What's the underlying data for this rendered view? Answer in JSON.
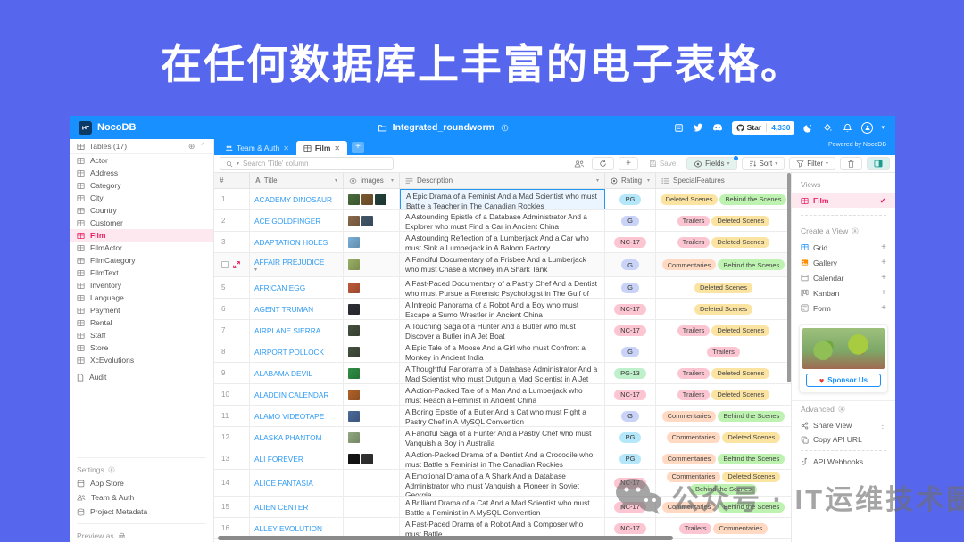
{
  "banner": {
    "title": "在任何数据库上丰富的电子表格。"
  },
  "header": {
    "app_name": "NocoDB",
    "project_name": "Integrated_roundworm",
    "star_label": "Star",
    "star_count": "4,330",
    "powered_by": "Powered by NocoDB",
    "accent_blue": "#1890FF",
    "background_purple": "#5667EE"
  },
  "tabs": [
    {
      "label": "Team & Auth",
      "active": false
    },
    {
      "label": "Film",
      "active": true
    }
  ],
  "left_sidebar": {
    "tables_header": "Tables (17)",
    "tables": [
      "Actor",
      "Address",
      "Category",
      "City",
      "Country",
      "Customer",
      "Film",
      "FilmActor",
      "FilmCategory",
      "FilmText",
      "Inventory",
      "Language",
      "Payment",
      "Rental",
      "Staff",
      "Store",
      "XcEvolutions"
    ],
    "active_table": "Film",
    "audit_label": "Audit",
    "settings_label": "Settings",
    "settings_items": [
      "App Store",
      "Team & Auth",
      "Project Metadata"
    ],
    "preview_label": "Preview as"
  },
  "toolbar": {
    "search_placeholder": "Search 'Title' column",
    "save_label": "Save",
    "fields_label": "Fields",
    "sort_label": "Sort",
    "filter_label": "Filter"
  },
  "table": {
    "columns": [
      "#",
      "Title",
      "images",
      "Description",
      "Rating",
      "SpecialFeatures"
    ],
    "rating_colors": {
      "G": "#C9D3F7",
      "PG": "#B5E7FB",
      "PG-13": "#BDF0CB",
      "NC-17": "#FBC6D2"
    },
    "feature_colors": {
      "Trailers": "#FBC6D2",
      "Deleted Scenes": "#FBE3A1",
      "Behind the Scenes": "#BDF2B0",
      "Commentaries": "#FFD9C2"
    },
    "rows": [
      {
        "num": "1",
        "title": "ACADEMY DINOSAUR",
        "thumbs": [
          "#4a6b3a",
          "#7a5a30",
          "#23423a"
        ],
        "desc": "A Epic Drama of a Feminist And a Mad Scientist who must Battle a Teacher in The Canadian Rockies",
        "rating": "PG",
        "features": [
          "Deleted Scenes",
          "Behind the Scenes"
        ],
        "desc_selected": true
      },
      {
        "num": "2",
        "title": "ACE GOLDFINGER",
        "thumbs": [
          "#8a6a4a",
          "#44586b"
        ],
        "desc": "A Astounding Epistle of a Database Administrator And a Explorer who must Find a Car in Ancient China",
        "rating": "G",
        "features": [
          "Trailers",
          "Deleted Scenes"
        ]
      },
      {
        "num": "3",
        "title": "ADAPTATION HOLES",
        "thumbs": [
          "#7ab0d8"
        ],
        "desc": "A Astounding Reflection of a Lumberjack And a Car who must Sink a Lumberjack in A Baloon Factory",
        "rating": "NC-17",
        "features": [
          "Trailers",
          "Deleted Scenes"
        ]
      },
      {
        "num": "4",
        "title": "AFFAIR PREJUDICE",
        "thumbs": [
          "#9ab064"
        ],
        "desc": "A Fanciful Documentary of a Frisbee And a Lumberjack who must Chase a Monkey in A Shark Tank",
        "rating": "G",
        "features": [
          "Commentaries",
          "Behind the Scenes"
        ],
        "hover": true
      },
      {
        "num": "5",
        "title": "AFRICAN EGG",
        "thumbs": [
          "#c05a3a"
        ],
        "desc": "A Fast-Paced Documentary of a Pastry Chef And a Dentist who must Pursue a Forensic Psychologist in The Gulf of Mexico",
        "rating": "G",
        "features": [
          "Deleted Scenes"
        ]
      },
      {
        "num": "6",
        "title": "AGENT TRUMAN",
        "thumbs": [
          "#2e2e38"
        ],
        "desc": "A Intrepid Panorama of a Robot And a Boy who must Escape a Sumo Wrestler in Ancient China",
        "rating": "NC-17",
        "features": [
          "Deleted Scenes"
        ]
      },
      {
        "num": "7",
        "title": "AIRPLANE SIERRA",
        "thumbs": [
          "#44503f"
        ],
        "desc": "A Touching Saga of a Hunter And a Butler who must Discover a Butler in A Jet Boat",
        "rating": "NC-17",
        "features": [
          "Trailers",
          "Deleted Scenes"
        ]
      },
      {
        "num": "8",
        "title": "AIRPORT POLLOCK",
        "thumbs": [
          "#44503f"
        ],
        "desc": "A Epic Tale of a Moose And a Girl who must Confront a Monkey in Ancient India",
        "rating": "G",
        "features": [
          "Trailers"
        ]
      },
      {
        "num": "9",
        "title": "ALABAMA DEVIL",
        "thumbs": [
          "#2f8f45"
        ],
        "desc": "A Thoughtful Panorama of a Database Administrator And a Mad Scientist who must Outgun a Mad Scientist in A Jet Boat",
        "rating": "PG-13",
        "features": [
          "Trailers",
          "Deleted Scenes"
        ]
      },
      {
        "num": "10",
        "title": "ALADDIN CALENDAR",
        "thumbs": [
          "#b2622a"
        ],
        "desc": "A Action-Packed Tale of a Man And a Lumberjack who must Reach a Feminist in Ancient China",
        "rating": "NC-17",
        "features": [
          "Trailers",
          "Deleted Scenes"
        ]
      },
      {
        "num": "11",
        "title": "ALAMO VIDEOTAPE",
        "thumbs": [
          "#4a6a9a"
        ],
        "desc": "A Boring Epistle of a Butler And a Cat who must Fight a Pastry Chef in A MySQL Convention",
        "rating": "G",
        "features": [
          "Commentaries",
          "Behind the Scenes"
        ]
      },
      {
        "num": "12",
        "title": "ALASKA PHANTOM",
        "thumbs": [
          "#90a87e"
        ],
        "desc": "A Fanciful Saga of a Hunter And a Pastry Chef who must Vanquish a Boy in Australia",
        "rating": "PG",
        "features": [
          "Commentaries",
          "Deleted Scenes"
        ]
      },
      {
        "num": "13",
        "title": "ALI FOREVER",
        "thumbs": [
          "#141414",
          "#333333"
        ],
        "desc": "A Action-Packed Drama of a Dentist And a Crocodile who must Battle a Feminist in The Canadian Rockies",
        "rating": "PG",
        "features": [
          "Commentaries",
          "Behind the Scenes"
        ]
      },
      {
        "num": "14",
        "title": "ALICE FANTASIA",
        "thumbs": [],
        "desc": "A Emotional Drama of a A Shark And a Database Administrator who must Vanquish a Pioneer in Soviet Georgia",
        "rating": "NC-17",
        "features": [
          "Commentaries",
          "Deleted Scenes",
          "Behind the Scenes"
        ],
        "tall": true
      },
      {
        "num": "15",
        "title": "ALIEN CENTER",
        "thumbs": [],
        "desc": "A Brilliant Drama of a Cat And a Mad Scientist who must Battle a Feminist in A MySQL Convention",
        "rating": "NC-17",
        "features": [
          "Commentaries",
          "Behind the Scenes"
        ]
      },
      {
        "num": "16",
        "title": "ALLEY EVOLUTION",
        "thumbs": [],
        "desc": "A Fast-Paced Drama of a Robot And a Composer who must Battle",
        "rating": "NC-17",
        "features": [
          "Trailers",
          "Commentaries"
        ]
      }
    ]
  },
  "views_sidebar": {
    "views_label": "Views",
    "active_view": "Film",
    "create_label": "Create a View",
    "create_items": [
      {
        "label": "Grid",
        "color": "#1890FF"
      },
      {
        "label": "Gallery",
        "color": "#FB8C00"
      },
      {
        "label": "Calendar",
        "color": "#8a8a8a"
      },
      {
        "label": "Kanban",
        "color": "#8a8a8a"
      },
      {
        "label": "Form",
        "color": "#8a8a8a"
      }
    ],
    "sponsor_label": "Sponsor Us",
    "advanced_label": "Advanced",
    "share_view": "Share View",
    "copy_api_url": "Copy API URL",
    "api_webhooks": "API Webhooks"
  },
  "watermark": {
    "text": "公众号 · IT运维技术圈"
  }
}
